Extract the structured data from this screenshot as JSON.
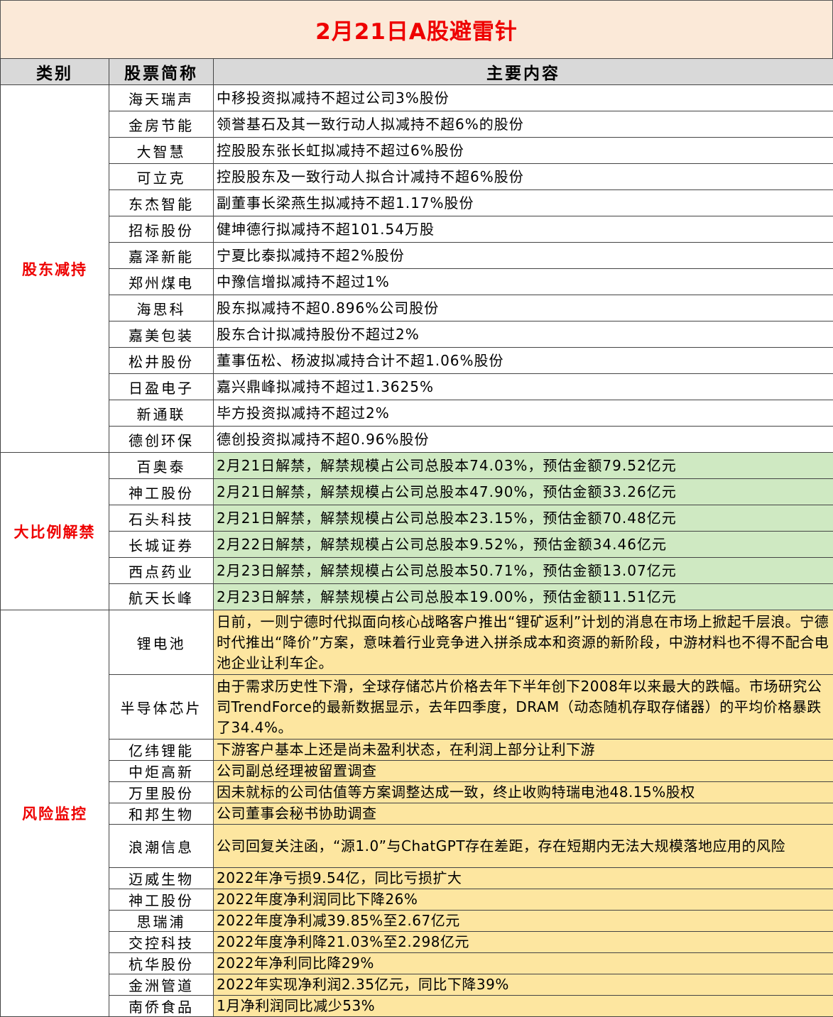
{
  "title": "2月21日A股避雷针",
  "headers": {
    "category": "类别",
    "stock": "股票简称",
    "content": "主要内容"
  },
  "sections": [
    {
      "category": "股东减持",
      "rows": [
        {
          "stock": "海天瑞声",
          "content": "中移投资拟减持不超过公司3%股份"
        },
        {
          "stock": "金房节能",
          "content": "领誉基石及其一致行动人拟减持不超6%的股份"
        },
        {
          "stock": "大智慧",
          "content": "控股股东张长虹拟减持不超过6%股份"
        },
        {
          "stock": "可立克",
          "content": "控股股东及一致行动人拟合计减持不超6%股份"
        },
        {
          "stock": "东杰智能",
          "content": "副董事长梁燕生拟减持不超1.17%股份"
        },
        {
          "stock": "招标股份",
          "content": "健坤德行拟减持不超101.54万股"
        },
        {
          "stock": "嘉泽新能",
          "content": "宁夏比泰拟减持不超2%股份"
        },
        {
          "stock": "郑州煤电",
          "content": "中豫信增拟减持不超过1%"
        },
        {
          "stock": "海思科",
          "content": "股东拟减持不超0.896%公司股份"
        },
        {
          "stock": "嘉美包装",
          "content": "股东合计拟减持股份不超过2%"
        },
        {
          "stock": "松井股份",
          "content": "董事伍松、杨波拟减持合计不超1.06%股份"
        },
        {
          "stock": "日盈电子",
          "content": "嘉兴鼎峰拟减持不超过1.3625%"
        },
        {
          "stock": "新通联",
          "content": "毕方投资拟减持不超过2%"
        },
        {
          "stock": "德创环保",
          "content": "德创投资拟减持不超0.96%股份"
        }
      ]
    },
    {
      "category": "大比例解禁",
      "rows": [
        {
          "stock": "百奥泰",
          "content": "2月21日解禁，解禁规模占公司总股本74.03%，预估金额79.52亿元"
        },
        {
          "stock": "神工股份",
          "content": "2月21日解禁，解禁规模占公司总股本47.90%，预估金额33.26亿元"
        },
        {
          "stock": "石头科技",
          "content": "2月21日解禁，解禁规模占公司总股本23.15%，预估金额70.48亿元"
        },
        {
          "stock": "长城证券",
          "content": "2月22日解禁，解禁规模占公司总股本9.52%，预估金额34.46亿元"
        },
        {
          "stock": "西点药业",
          "content": "2月23日解禁，解禁规模占公司总股本50.71%，预估金额13.07亿元"
        },
        {
          "stock": "航天长峰",
          "content": "2月23日解禁，解禁规模占公司总股本19.00%，预估金额11.51亿元"
        }
      ]
    },
    {
      "category": "风险监控",
      "rows": [
        {
          "stock": "锂电池",
          "content": "日前，一则宁德时代拟面向核心战略客户推出“锂矿返利”计划的消息在市场上掀起千层浪。宁德时代推出“降价”方案，意味着行业竞争进入拼杀成本和资源的新阶段，中游材料也不得不配合电池企业让利车企。"
        },
        {
          "stock": "半导体芯片",
          "content": "由于需求历史性下滑，全球存储芯片价格去年下半年创下2008年以来最大的跌幅。市场研究公司TrendForce的最新数据显示，去年四季度，DRAM（动态随机存取存储器）的平均价格暴跌了34.4%。"
        },
        {
          "stock": "亿纬锂能",
          "content": "下游客户基本上还是尚未盈利状态，在利润上部分让利下游"
        },
        {
          "stock": "中炬高新",
          "content": "公司副总经理被留置调查"
        },
        {
          "stock": "万里股份",
          "content": "因未就标的公司估值等方案调整达成一致，终止收购特瑞电池48.15%股权"
        },
        {
          "stock": "和邦生物",
          "content": "公司董事会秘书协助调查"
        },
        {
          "stock": "浪潮信息",
          "content": "公司回复关注函，“源1.0”与ChatGPT存在差距，存在短期内无法大规模落地应用的风险"
        },
        {
          "stock": "迈威生物",
          "content": "2022年净亏损9.54亿，同比亏损扩大"
        },
        {
          "stock": "神工股份",
          "content": "2022年度净利润同比下降26%"
        },
        {
          "stock": "思瑞浦",
          "content": "2022年度净利减39.85%至2.67亿元"
        },
        {
          "stock": "交控科技",
          "content": "2022年度净利降21.03%至2.298亿元"
        },
        {
          "stock": "杭华股份",
          "content": "2022年净利同比降29%"
        },
        {
          "stock": "金洲管道",
          "content": "2022年实现净利润2.35亿元，同比下降39%"
        },
        {
          "stock": "南侨食品",
          "content": "1月净利润同比减少53%"
        }
      ]
    }
  ]
}
